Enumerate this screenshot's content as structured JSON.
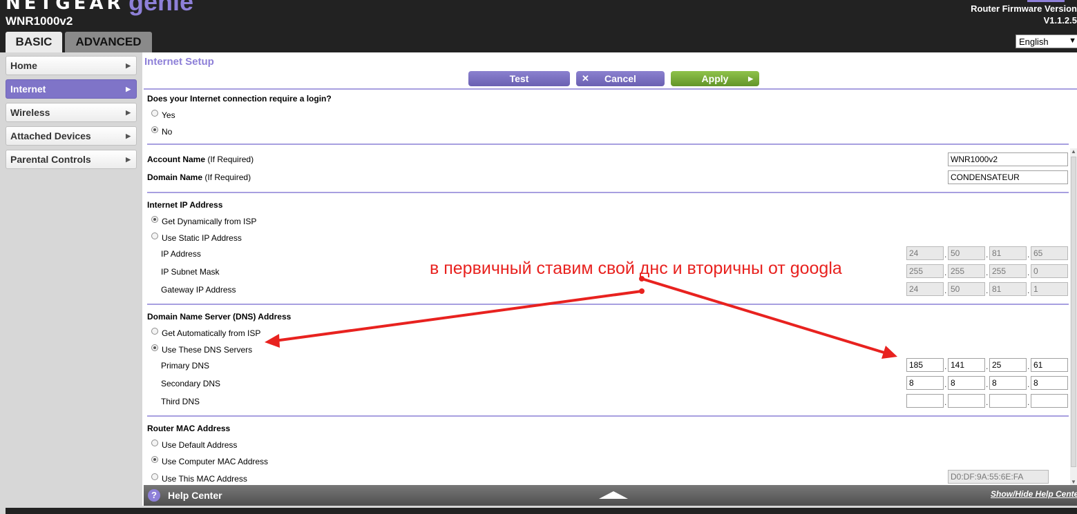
{
  "header": {
    "brand": "NETGEAR",
    "product": "genie",
    "model": "WNR1000v2",
    "firmware_label": "Router Firmware Version",
    "firmware_version": "V1.1.2.5",
    "language": "English",
    "tabs": [
      {
        "label": "BASIC"
      },
      {
        "label": "ADVANCED"
      }
    ]
  },
  "sidebar": {
    "items": [
      {
        "label": "Home"
      },
      {
        "label": "Internet"
      },
      {
        "label": "Wireless"
      },
      {
        "label": "Attached Devices"
      },
      {
        "label": "Parental Controls"
      }
    ],
    "active": "Internet"
  },
  "page": {
    "title": "Internet Setup",
    "buttons": {
      "test": "Test",
      "cancel": "Cancel",
      "apply": "Apply"
    }
  },
  "login": {
    "question": "Does your Internet connection require a login?",
    "yes": "Yes",
    "no": "No",
    "selected": "No"
  },
  "account": {
    "account_label": "Account Name",
    "account_note": "(If Required)",
    "account_value": "WNR1000v2",
    "domain_label": "Domain Name",
    "domain_note": "(If Required)",
    "domain_value": "CONDENSATEUR"
  },
  "ip": {
    "heading": "Internet IP Address",
    "dynamic": "Get Dynamically from ISP",
    "static": "Use Static IP Address",
    "selected": "Get Dynamically from ISP",
    "ip_label": "IP Address",
    "ip": [
      "24",
      "50",
      "81",
      "65"
    ],
    "mask_label": "IP Subnet Mask",
    "mask": [
      "255",
      "255",
      "255",
      "0"
    ],
    "gw_label": "Gateway IP Address",
    "gw": [
      "24",
      "50",
      "81",
      "1"
    ]
  },
  "dns": {
    "heading": "Domain Name Server (DNS) Address",
    "auto": "Get Automatically from ISP",
    "manual": "Use These DNS Servers",
    "selected": "Use These DNS Servers",
    "primary_label": "Primary DNS",
    "primary": [
      "185",
      "141",
      "25",
      "61"
    ],
    "secondary_label": "Secondary DNS",
    "secondary": [
      "8",
      "8",
      "8",
      "8"
    ],
    "third_label": "Third DNS",
    "third": [
      "",
      "",
      "",
      ""
    ]
  },
  "mac": {
    "heading": "Router MAC Address",
    "default": "Use Default Address",
    "computer": "Use Computer MAC Address",
    "this": "Use This MAC Address",
    "selected": "Use Computer MAC Address",
    "value": "D0:DF:9A:55:6E:FA"
  },
  "footer": {
    "help_label": "Help Center",
    "toggle_link": "Show/Hide Help Center"
  },
  "annotation": {
    "text": "в первичный ставим свой днс и вторичны от googla",
    "color": "#e8221f"
  },
  "colors": {
    "accent": "#8e80d8",
    "apply": "#7cb342",
    "header": "#222222"
  }
}
